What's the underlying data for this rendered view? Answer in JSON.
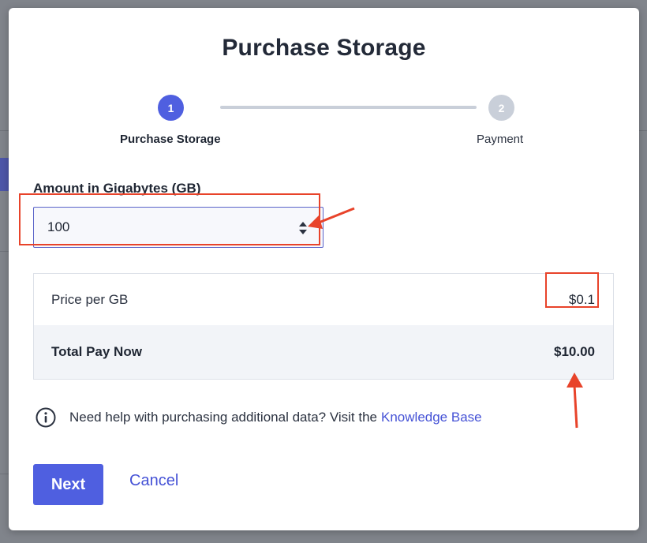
{
  "modal": {
    "title": "Purchase Storage"
  },
  "stepper": {
    "steps": [
      {
        "number": "1",
        "label": "Purchase Storage",
        "state": "active"
      },
      {
        "number": "2",
        "label": "Payment",
        "state": "inactive"
      }
    ]
  },
  "amount": {
    "label": "Amount in Gigabytes (GB)",
    "value": "100"
  },
  "pricing": {
    "price_per_gb_label": "Price per GB",
    "price_per_gb_value": "$0.1",
    "total_label": "Total Pay Now",
    "total_value": "$10.00"
  },
  "help": {
    "text": "Need help with purchasing additional data? Visit the",
    "link_label": "Knowledge Base",
    "icon": "info-icon"
  },
  "actions": {
    "next_label": "Next",
    "cancel_label": "Cancel"
  },
  "colors": {
    "primary": "#4f5fe0",
    "link": "#4552d6",
    "annotation": "#e8432a",
    "step_inactive": "#c9cfd9"
  }
}
